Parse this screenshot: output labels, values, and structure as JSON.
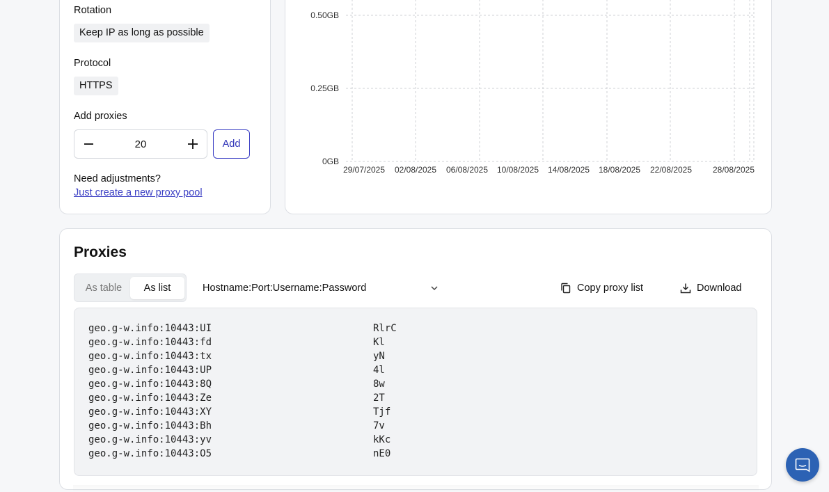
{
  "settings": {
    "rotation_label": "Rotation",
    "rotation_value": "Keep IP as long as possible",
    "protocol_label": "Protocol",
    "protocol_value": "HTTPS",
    "add_proxies_label": "Add proxies",
    "quantity": "20",
    "add_button": "Add",
    "adjust_text": "Need adjustments?",
    "adjust_link": "Just create a new proxy pool"
  },
  "chart_data": {
    "type": "line",
    "y_ticks": [
      "0GB",
      "0.25GB",
      "0.50GB"
    ],
    "x_ticks": [
      "29/07/2025",
      "02/08/2025",
      "06/08/2025",
      "10/08/2025",
      "14/08/2025",
      "18/08/2025",
      "22/08/2025",
      "28/08/2025"
    ],
    "grid": true,
    "series": []
  },
  "proxies": {
    "title": "Proxies",
    "view_options": [
      "As table",
      "As list"
    ],
    "selected_view": "As list",
    "format": "Hostname:Port:Username:Password",
    "copy_label": "Copy proxy list",
    "download_label": "Download",
    "lines": [
      {
        "prefix": "geo.g-w.info:10443:UI",
        "suffix": "RlrC"
      },
      {
        "prefix": "geo.g-w.info:10443:fd",
        "suffix": "Kl"
      },
      {
        "prefix": "geo.g-w.info:10443:tx",
        "suffix": "yN"
      },
      {
        "prefix": "geo.g-w.info:10443:UP",
        "suffix": "4l"
      },
      {
        "prefix": "geo.g-w.info:10443:8Q",
        "suffix": "8w"
      },
      {
        "prefix": "geo.g-w.info:10443:Ze",
        "suffix": "2T"
      },
      {
        "prefix": "geo.g-w.info:10443:XY",
        "suffix": "Tjf"
      },
      {
        "prefix": "geo.g-w.info:10443:Bh",
        "suffix": "7v"
      },
      {
        "prefix": "geo.g-w.info:10443:yv",
        "suffix": "kKc"
      },
      {
        "prefix": "geo.g-w.info:10443:O5",
        "suffix": "nE0"
      }
    ]
  },
  "colors": {
    "accent": "#3b3fc4",
    "chat_button": "#2c62b4"
  },
  "icons": {
    "minus": "minus-icon",
    "plus": "plus-icon",
    "copy": "copy-icon",
    "download": "download-icon",
    "chevron": "chevron-down-icon",
    "chat": "chat-icon"
  }
}
